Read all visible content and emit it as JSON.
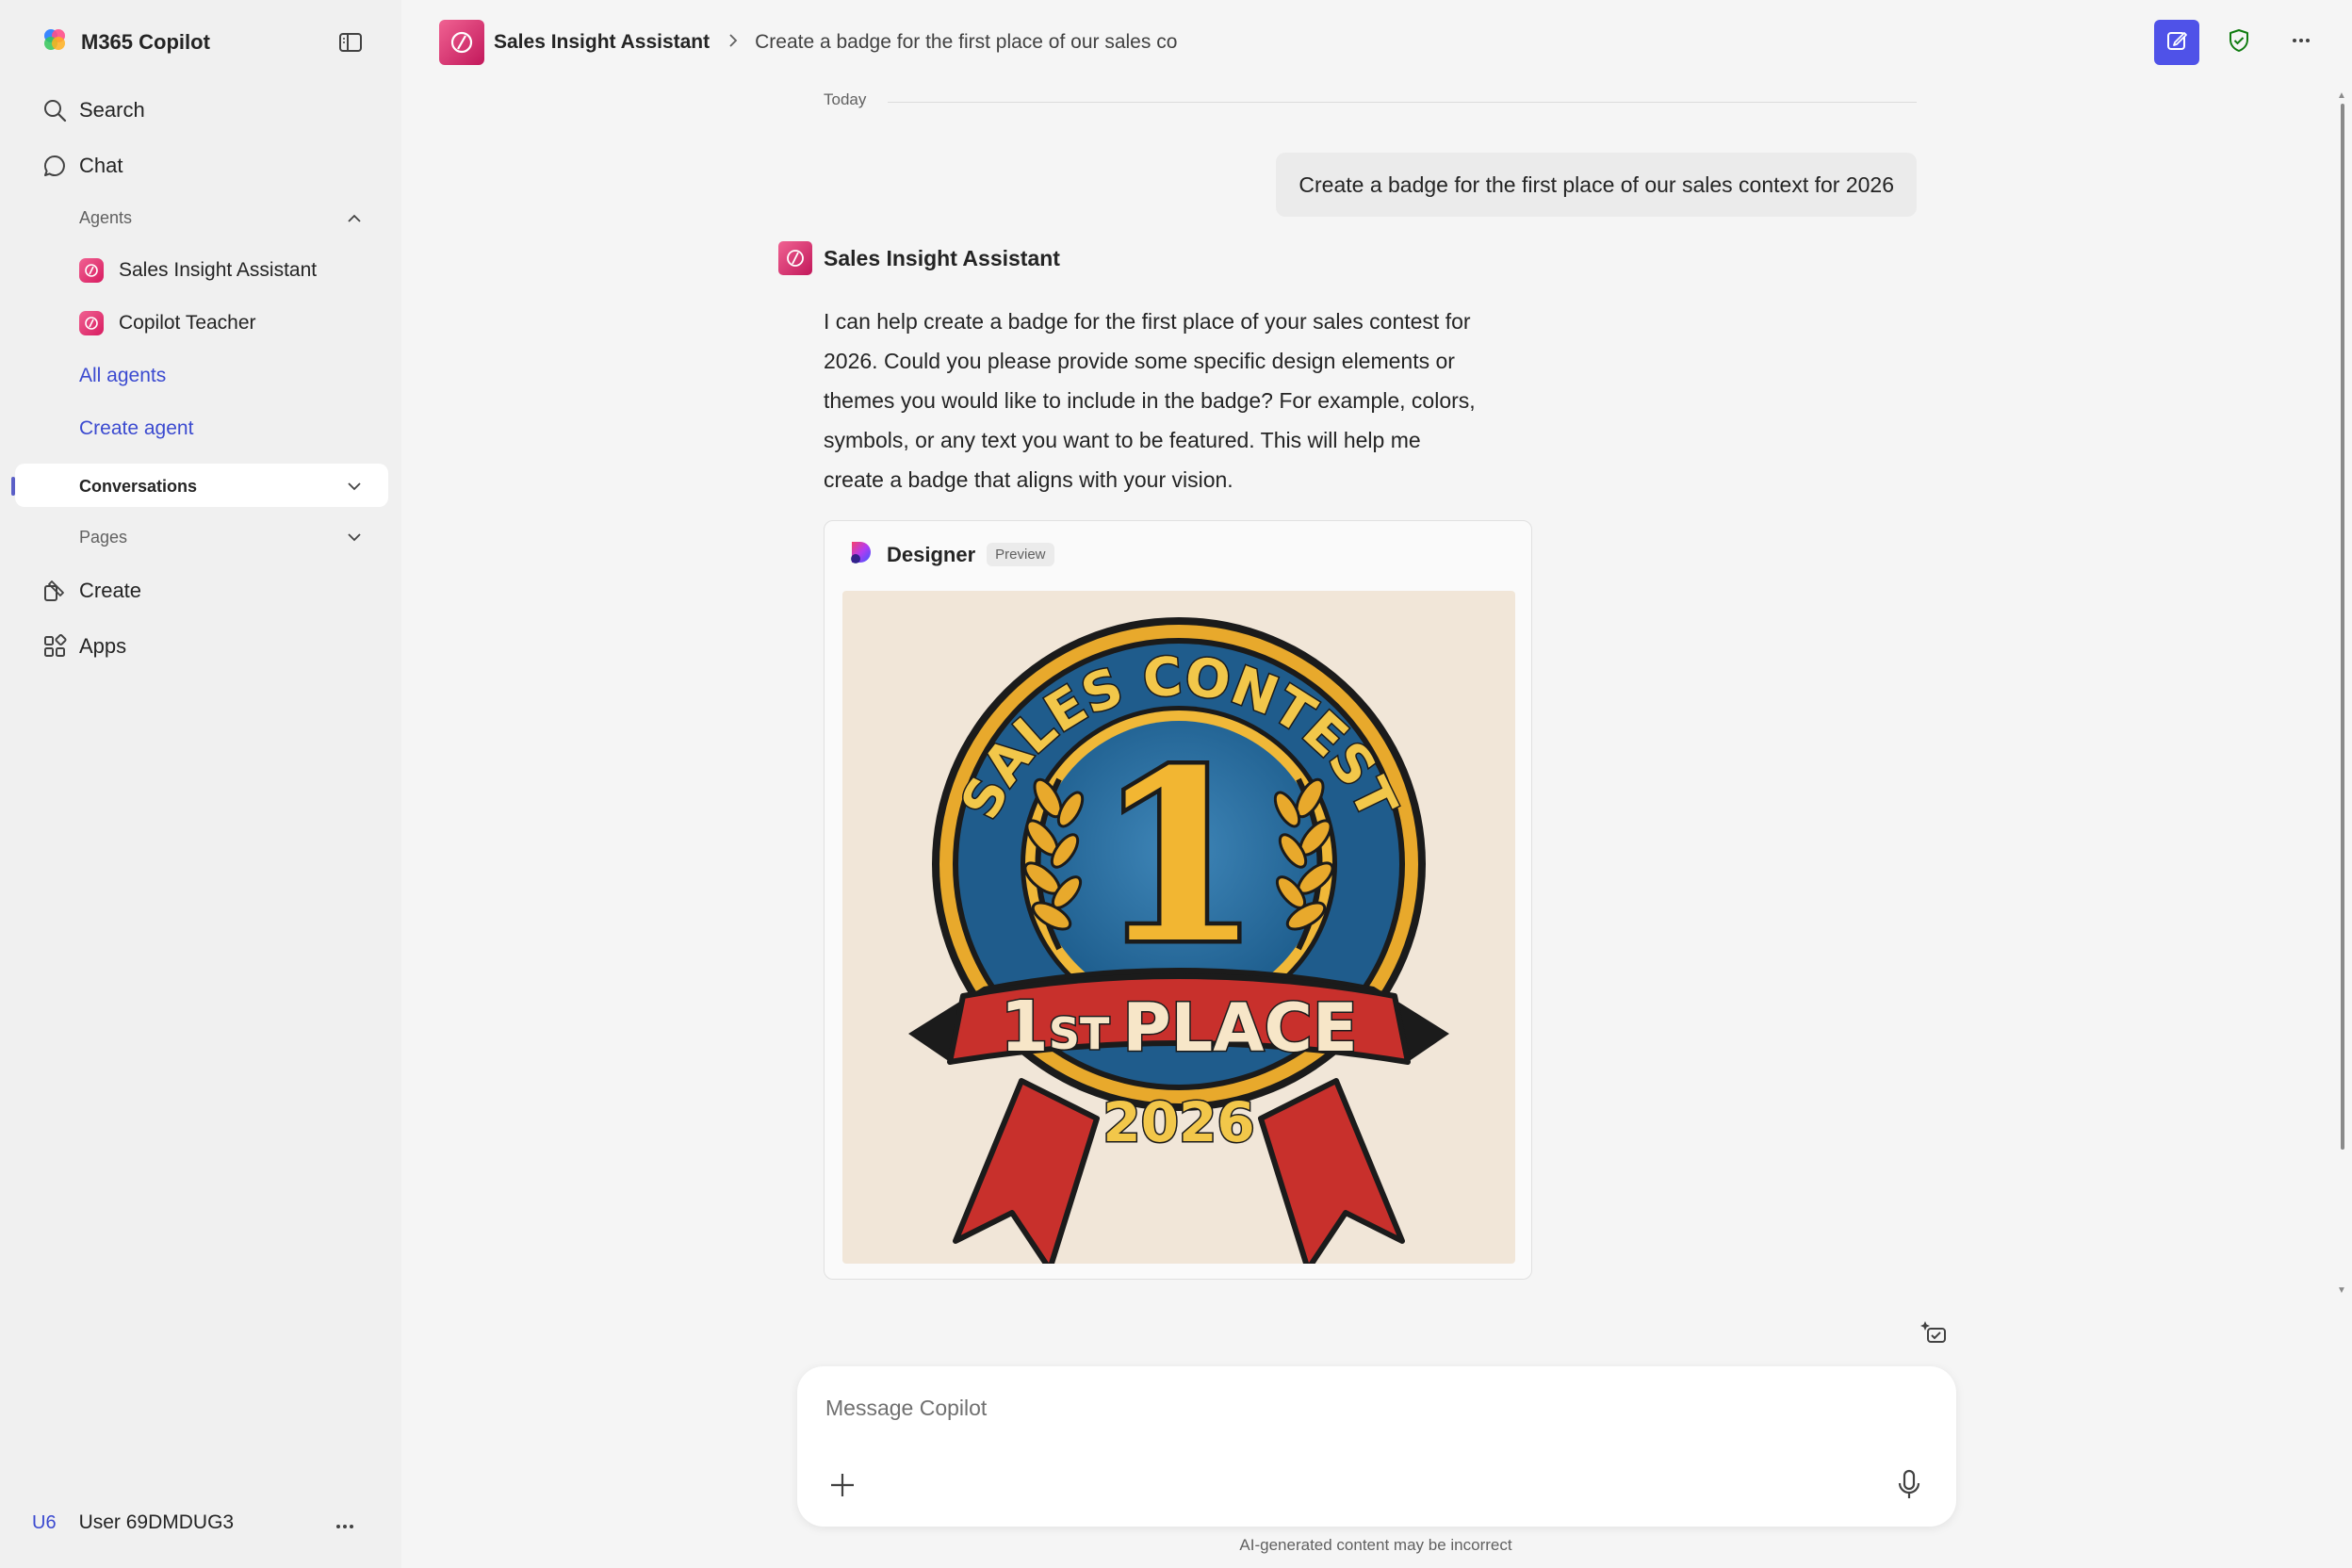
{
  "app": {
    "name": "M365 Copilot"
  },
  "sidebar": {
    "search_label": "Search",
    "chat_label": "Chat",
    "agents_header": "Agents",
    "agents": [
      {
        "label": "Sales Insight Assistant"
      },
      {
        "label": "Copilot Teacher"
      }
    ],
    "all_agents_label": "All agents",
    "create_agent_label": "Create agent",
    "conversations_label": "Conversations",
    "pages_label": "Pages",
    "create_label": "Create",
    "apps_label": "Apps",
    "user": {
      "initials": "U6",
      "name": "User 69DMDUG3"
    }
  },
  "topbar": {
    "agent_name": "Sales Insight Assistant",
    "conversation_title": "Create a badge for the first place of our sales co",
    "accent_color": "#4f52e8"
  },
  "chat": {
    "date_divider": "Today",
    "user_message": "Create a badge for the first place of our sales context for 2026",
    "bot_name": "Sales Insight Assistant",
    "bot_message": "I can help create a badge for the first place of your sales contest for 2026. Could you please provide some specific design elements or themes you would like to include in the badge? For example, colors, symbols, or any text you want to be featured. This will help me create a badge that aligns with your vision.",
    "designer": {
      "title": "Designer",
      "tag": "Preview",
      "image": {
        "arc_text": "SALES CONTEST",
        "number": "1",
        "ribbon_text_big": "1",
        "ribbon_text_suffix": "ST",
        "ribbon_text": "PLACE",
        "year": "2026"
      }
    }
  },
  "composer": {
    "placeholder": "Message Copilot",
    "disclaimer": "AI-generated content may be incorrect"
  }
}
